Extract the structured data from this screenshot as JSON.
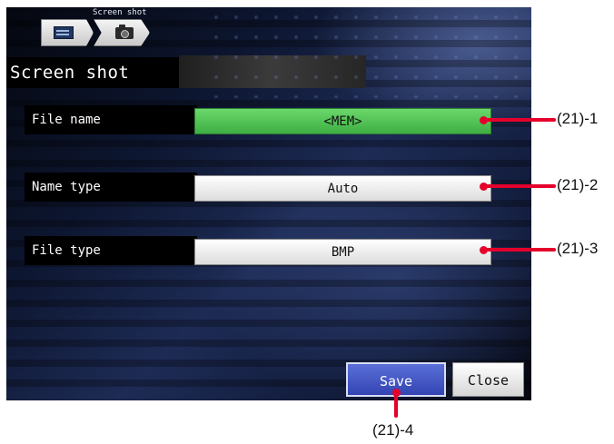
{
  "breadcrumb": {
    "caption": "Screen shot",
    "items": [
      {
        "icon": "menu-icon"
      },
      {
        "icon": "camera-icon"
      }
    ]
  },
  "screen": {
    "title": "Screen shot"
  },
  "settings": [
    {
      "label": "File name",
      "value": "<MEM>",
      "selected": true
    },
    {
      "label": "Name type",
      "value": "Auto",
      "selected": false
    },
    {
      "label": "File type",
      "value": "BMP",
      "selected": false
    }
  ],
  "buttons": {
    "save": "Save",
    "close": "Close"
  },
  "callouts": {
    "file_name": "(21)-1",
    "name_type": "(21)-2",
    "file_type": "(21)-3",
    "save": "(21)-4"
  },
  "colors": {
    "selected_value": "#4cc04f",
    "save_button": "#3f52c4",
    "callout": "#e4002b"
  }
}
